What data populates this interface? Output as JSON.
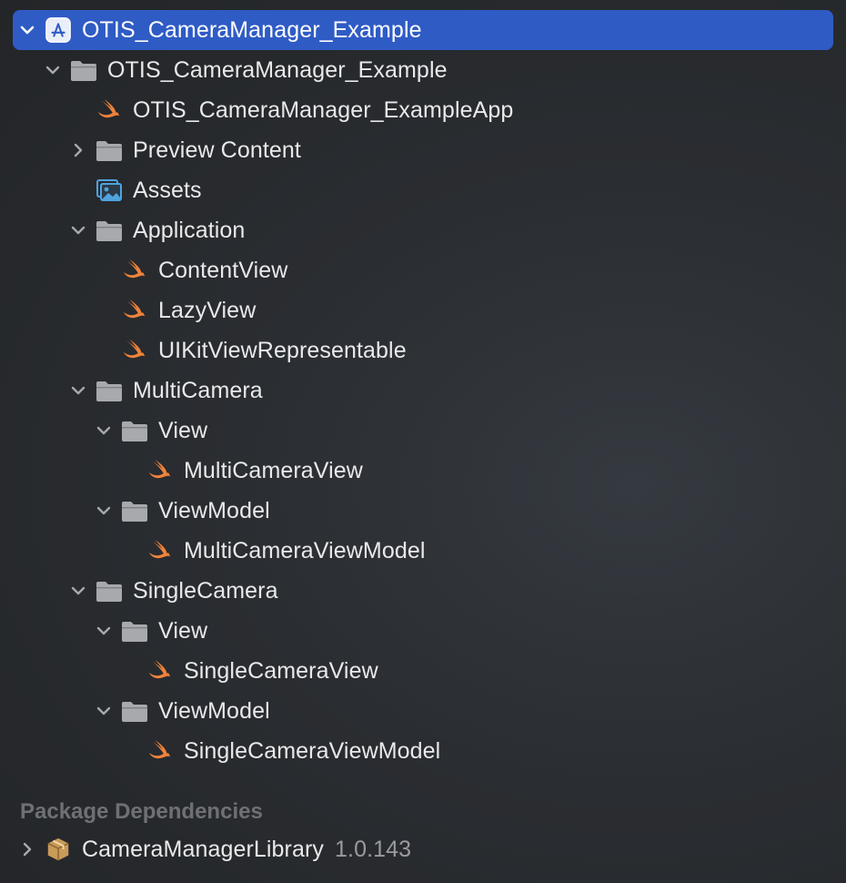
{
  "project_navigator": {
    "project": {
      "label": "OTIS_CameraManager_Example",
      "icon": "app-project-icon",
      "expanded": true,
      "selected": true
    },
    "items": [
      {
        "label": "OTIS_CameraManager_Example",
        "icon": "folder-icon",
        "expanded": true
      },
      {
        "label": "OTIS_CameraManager_ExampleApp",
        "icon": "swift-file-icon"
      },
      {
        "label": "Preview Content",
        "icon": "folder-icon",
        "expanded": false
      },
      {
        "label": "Assets",
        "icon": "asset-catalog-icon"
      },
      {
        "label": "Application",
        "icon": "folder-icon",
        "expanded": true
      },
      {
        "label": "ContentView",
        "icon": "swift-file-icon"
      },
      {
        "label": "LazyView",
        "icon": "swift-file-icon"
      },
      {
        "label": "UIKitViewRepresentable",
        "icon": "swift-file-icon"
      },
      {
        "label": "MultiCamera",
        "icon": "folder-icon",
        "expanded": true
      },
      {
        "label": "View",
        "icon": "folder-icon",
        "expanded": true
      },
      {
        "label": "MultiCameraView",
        "icon": "swift-file-icon"
      },
      {
        "label": "ViewModel",
        "icon": "folder-icon",
        "expanded": true
      },
      {
        "label": "MultiCameraViewModel",
        "icon": "swift-file-icon"
      },
      {
        "label": "SingleCamera",
        "icon": "folder-icon",
        "expanded": true
      },
      {
        "label": "View",
        "icon": "folder-icon",
        "expanded": true
      },
      {
        "label": "SingleCameraView",
        "icon": "swift-file-icon"
      },
      {
        "label": "ViewModel",
        "icon": "folder-icon",
        "expanded": true
      },
      {
        "label": "SingleCameraViewModel",
        "icon": "swift-file-icon"
      }
    ]
  },
  "package_dependencies": {
    "header": "Package Dependencies",
    "items": [
      {
        "label": "CameraManagerLibrary",
        "version": "1.0.143",
        "icon": "package-icon",
        "expanded": false
      }
    ]
  },
  "colors": {
    "selection": "#2f5bc5",
    "swift_orange": "#f0833a",
    "folder_gray": "#a7a9ac",
    "asset_blue": "#4fa3e0",
    "package_tan": "#c99a58"
  }
}
